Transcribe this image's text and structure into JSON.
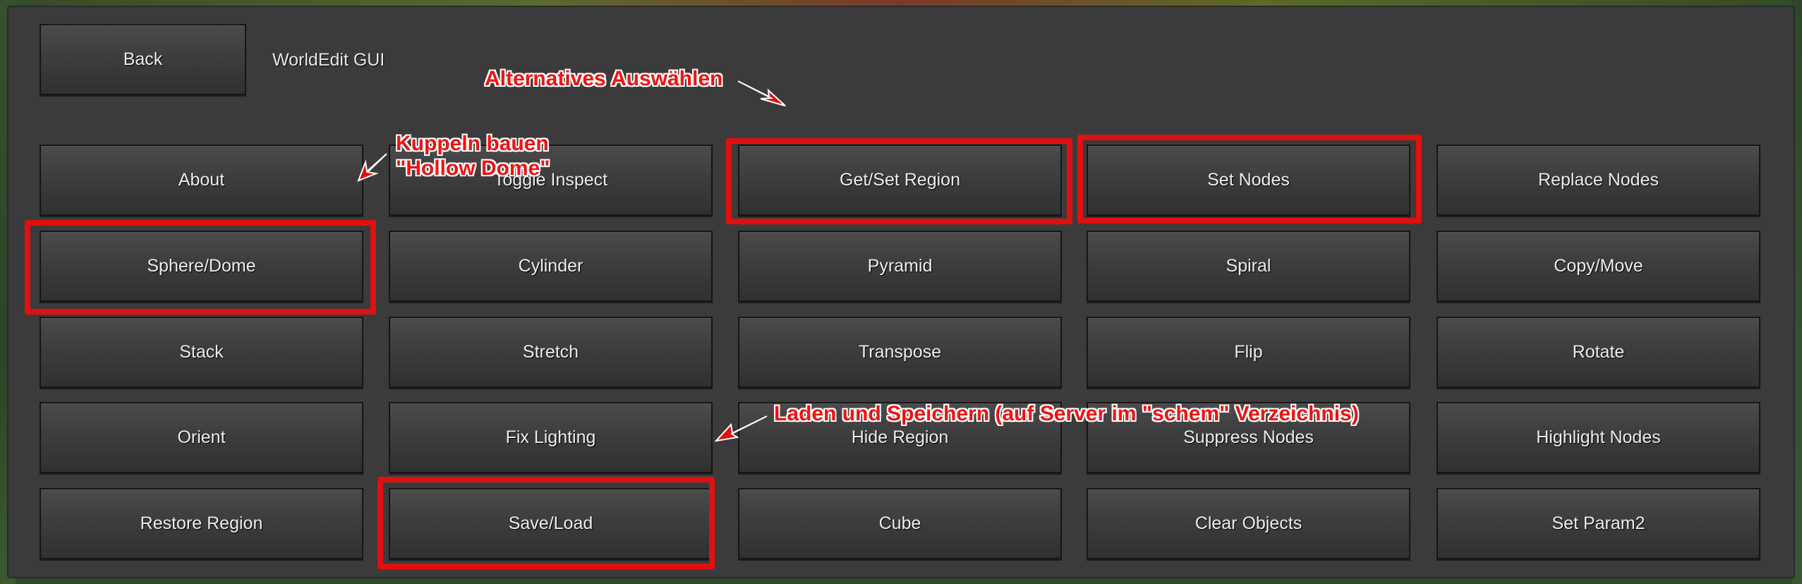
{
  "window": {
    "title": "WorldEdit GUI",
    "back_label": "Back"
  },
  "buttons": [
    {
      "id": "about",
      "label": "About"
    },
    {
      "id": "toggle-inspect",
      "label": "Toggle Inspect"
    },
    {
      "id": "get-set-region",
      "label": "Get/Set Region"
    },
    {
      "id": "set-nodes",
      "label": "Set Nodes"
    },
    {
      "id": "replace-nodes",
      "label": "Replace Nodes"
    },
    {
      "id": "sphere-dome",
      "label": "Sphere/Dome"
    },
    {
      "id": "cylinder",
      "label": "Cylinder"
    },
    {
      "id": "pyramid",
      "label": "Pyramid"
    },
    {
      "id": "spiral",
      "label": "Spiral"
    },
    {
      "id": "copy-move",
      "label": "Copy/Move"
    },
    {
      "id": "stack",
      "label": "Stack"
    },
    {
      "id": "stretch",
      "label": "Stretch"
    },
    {
      "id": "transpose",
      "label": "Transpose"
    },
    {
      "id": "flip",
      "label": "Flip"
    },
    {
      "id": "rotate",
      "label": "Rotate"
    },
    {
      "id": "orient",
      "label": "Orient"
    },
    {
      "id": "fix-lighting",
      "label": "Fix Lighting"
    },
    {
      "id": "hide-region",
      "label": "Hide Region"
    },
    {
      "id": "suppress-nodes",
      "label": "Suppress Nodes"
    },
    {
      "id": "highlight-nodes",
      "label": "Highlight Nodes"
    },
    {
      "id": "restore-region",
      "label": "Restore Region"
    },
    {
      "id": "save-load",
      "label": "Save/Load"
    },
    {
      "id": "cube",
      "label": "Cube"
    },
    {
      "id": "clear-objects",
      "label": "Clear Objects"
    },
    {
      "id": "set-param2",
      "label": "Set Param2"
    }
  ],
  "annotations": {
    "alternatives": "Alternatives Auswählen",
    "domes_line1": "Kuppeln bauen",
    "domes_line2": "\"Hollow Dome\"",
    "save_load_note": "Laden und Speichern (auf Server im \"schem\" Verzeichnis)"
  },
  "colors": {
    "panel": "#3b3b3b",
    "button": "#3d3d3d",
    "annotation": "#e10f0f"
  }
}
